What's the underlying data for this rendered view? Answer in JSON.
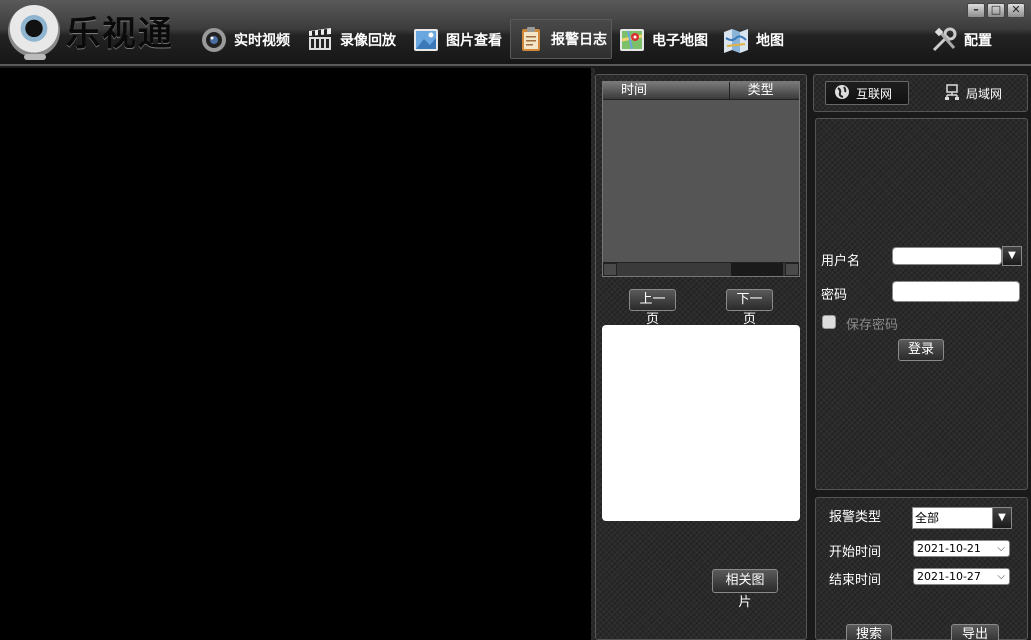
{
  "app": {
    "title": "乐视通"
  },
  "nav": [
    {
      "id": "live",
      "label": "实时视频",
      "icon": "camera-lens-icon"
    },
    {
      "id": "playback",
      "label": "录像回放",
      "icon": "clapperboard-icon"
    },
    {
      "id": "pictures",
      "label": "图片查看",
      "icon": "picture-icon"
    },
    {
      "id": "alarm",
      "label": "报警日志",
      "icon": "clipboard-icon",
      "active": true
    },
    {
      "id": "emap",
      "label": "电子地图",
      "icon": "map-pin-icon"
    },
    {
      "id": "map",
      "label": "地图",
      "icon": "folded-map-icon"
    },
    {
      "id": "config",
      "label": "配置",
      "icon": "tools-icon"
    }
  ],
  "window_controls": {
    "minimize": "–",
    "maximize": "□",
    "close": "✕"
  },
  "log": {
    "columns": [
      "时间",
      "类型"
    ],
    "prev_label": "上一页",
    "next_label": "下一页",
    "related_label": "相关图片"
  },
  "login": {
    "tab_internet": "互联网",
    "tab_lan": "局域网",
    "username_label": "用户名",
    "username_value": "",
    "password_label": "密码",
    "password_value": "",
    "save_password_label": "保存密码",
    "save_password_checked": false,
    "login_button": "登录"
  },
  "search": {
    "alarm_type_label": "报警类型",
    "alarm_type_value": "全部",
    "start_label": "开始时间",
    "start_value": "2021-10-21",
    "end_label": "结束时间",
    "end_value": "2021-10-27",
    "search_button": "搜索",
    "export_button": "导出"
  }
}
